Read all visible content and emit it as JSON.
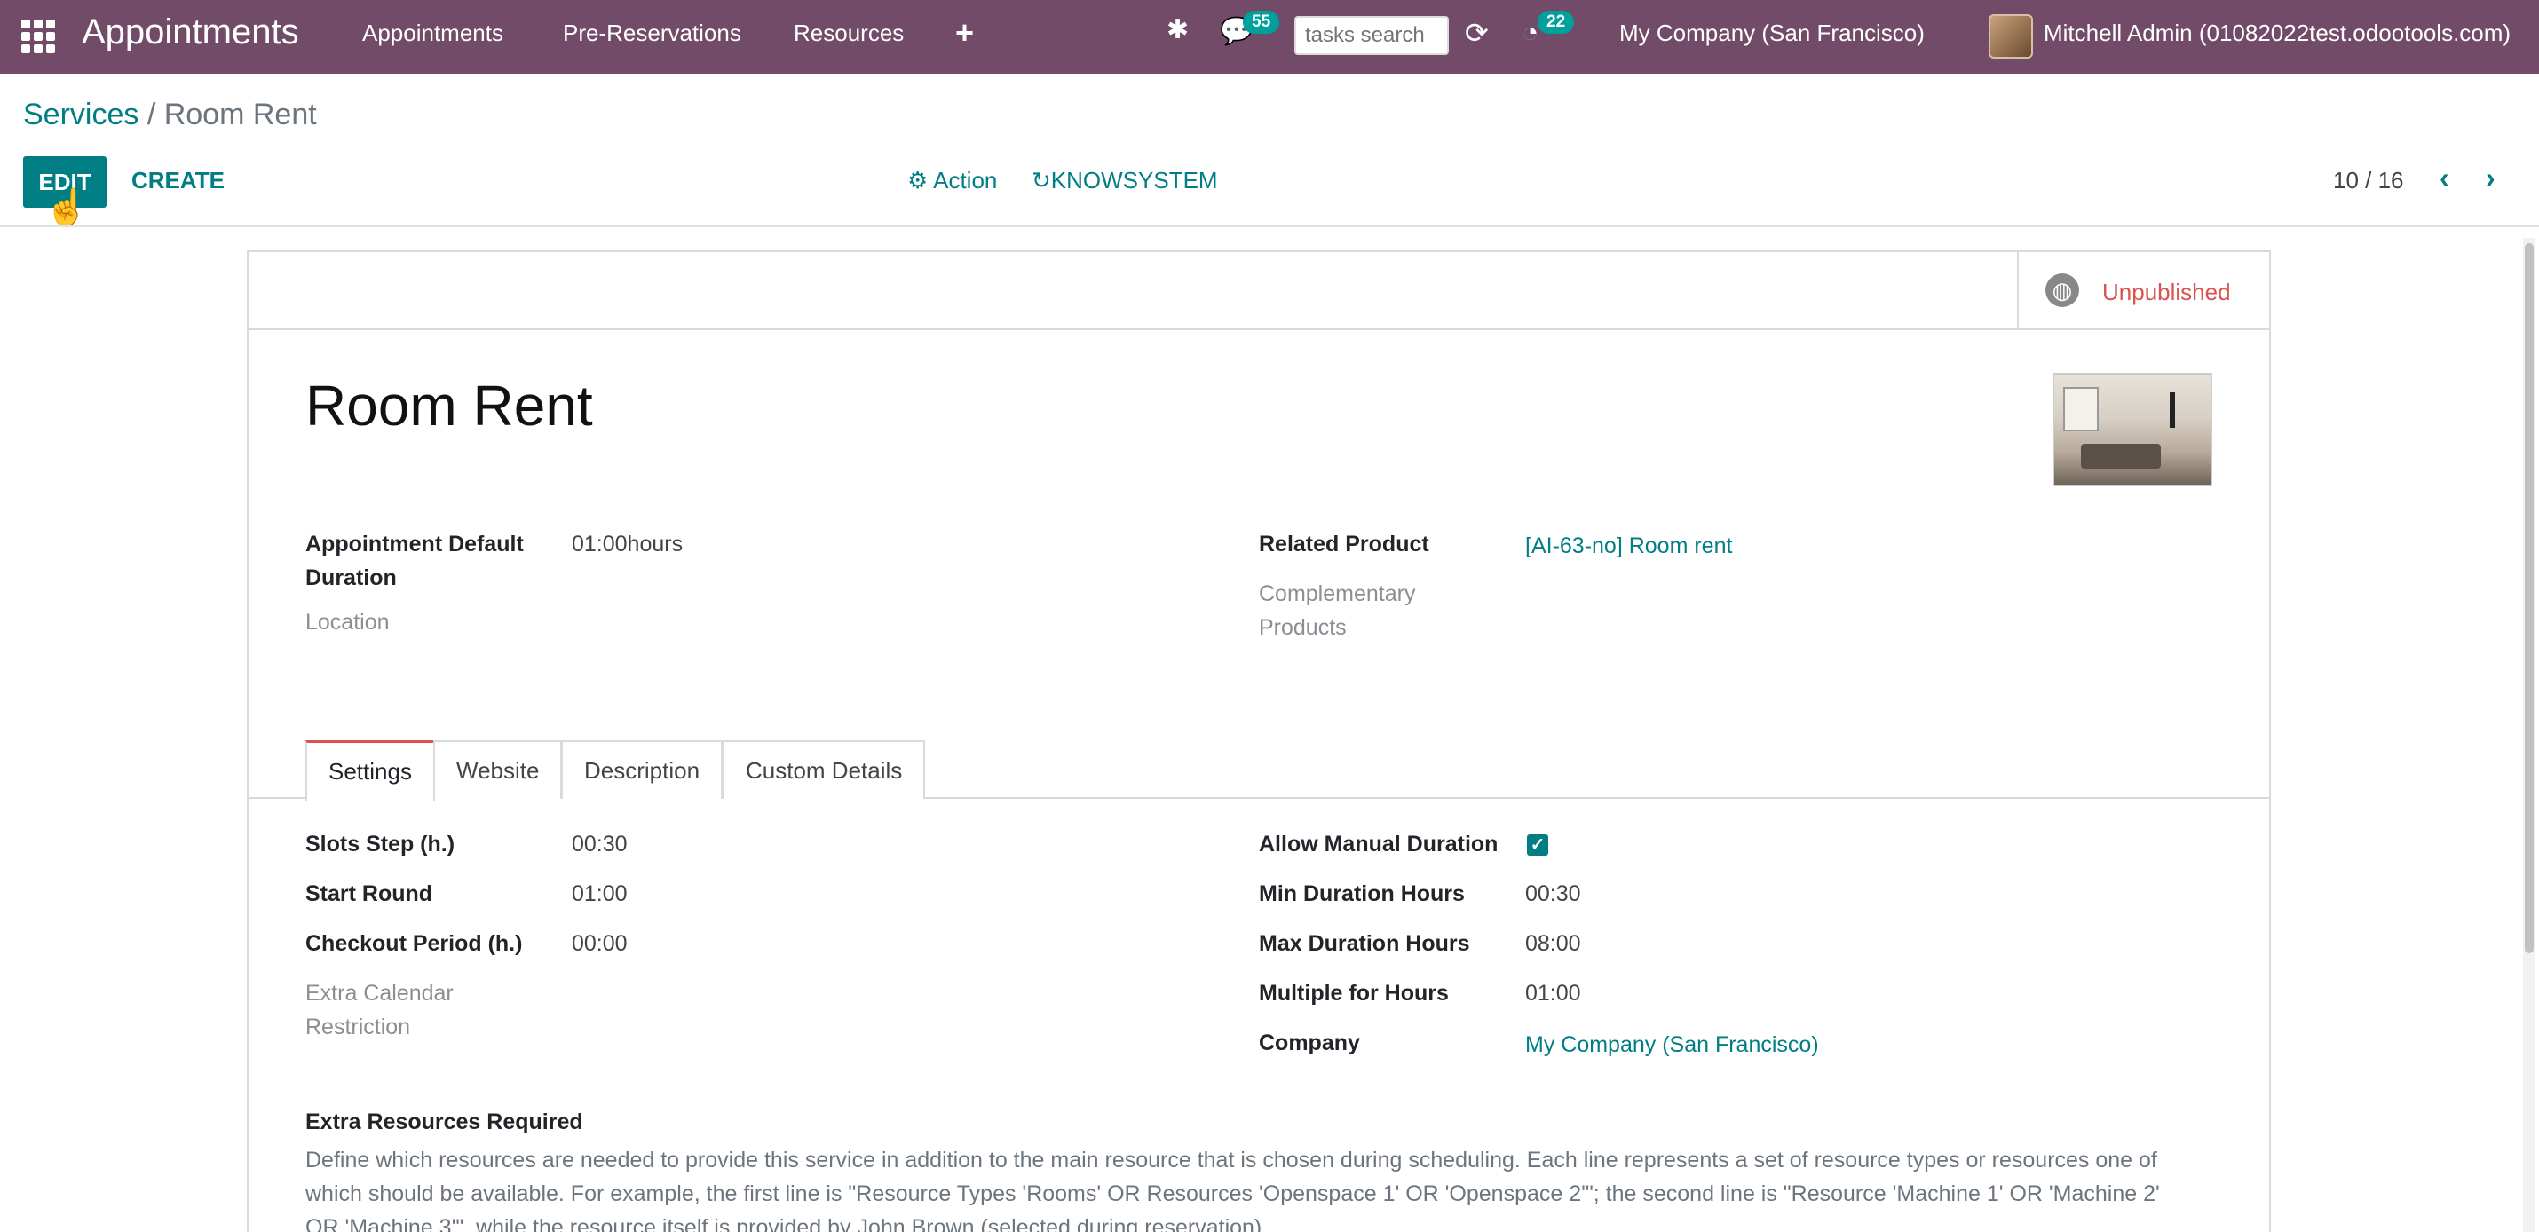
{
  "navbar": {
    "brand": "Appointments",
    "menu": [
      "Appointments",
      "Pre-Reservations",
      "Resources"
    ],
    "chat_badge": "55",
    "activity_badge": "22",
    "search_placeholder": "tasks search",
    "company": "My Company (San Francisco)",
    "user": "Mitchell Admin (01082022test.odootools.com)",
    "background_color": "#714b67"
  },
  "control_panel": {
    "breadcrumb_parent": "Services",
    "breadcrumb_sep": " / ",
    "breadcrumb_current": "Room Rent",
    "edit_label": "EDIT",
    "create_label": "CREATE",
    "action_label": "Action",
    "knowsystem_label": "KNOWSYSTEM",
    "pager": "10 / 16",
    "accent_color": "#017e84"
  },
  "form": {
    "publish_status": "Unpublished",
    "title": "Room Rent",
    "fields_left": [
      {
        "label": "Appointment Default",
        "label2": "Duration",
        "value": "01:00hours"
      },
      {
        "label": "Location",
        "value": ""
      }
    ],
    "fields_right": [
      {
        "label": "Related Product",
        "value": "[AI-63-no] Room rent"
      },
      {
        "label": "Complementary",
        "label2": "Products",
        "value": ""
      }
    ],
    "tabs": [
      "Settings",
      "Website",
      "Description",
      "Custom Details"
    ],
    "settings_left": [
      {
        "label": "Slots Step (h.)",
        "value": "00:30"
      },
      {
        "label": "Start Round",
        "value": "01:00"
      },
      {
        "label": "Checkout Period (h.)",
        "value": "00:00"
      },
      {
        "label": "Extra Calendar",
        "label2": "Restriction",
        "value": ""
      }
    ],
    "settings_right": [
      {
        "label": "Allow Manual Duration",
        "value": true
      },
      {
        "label": "Min Duration Hours",
        "value": "00:30"
      },
      {
        "label": "Max Duration Hours",
        "value": "08:00"
      },
      {
        "label": "Multiple for Hours",
        "value": "01:00"
      },
      {
        "label": "Company",
        "value": "My Company (San Francisco)"
      }
    ],
    "extra_resources_title": "Extra Resources Required",
    "extra_resources_help": "Define which resources are needed to provide this service in addition to the main resource that is chosen during scheduling. Each line represents a set of resource types or resources one of which should be available. For example, the first line is \"Resource Types 'Rooms' OR Resources 'Openspace 1' OR 'Openspace 2'\"; the second line is \"Resource 'Machine 1' OR 'Machine 2' OR 'Machine 3'\", while the resource itself is provided by John Brown (selected during reservation)"
  }
}
